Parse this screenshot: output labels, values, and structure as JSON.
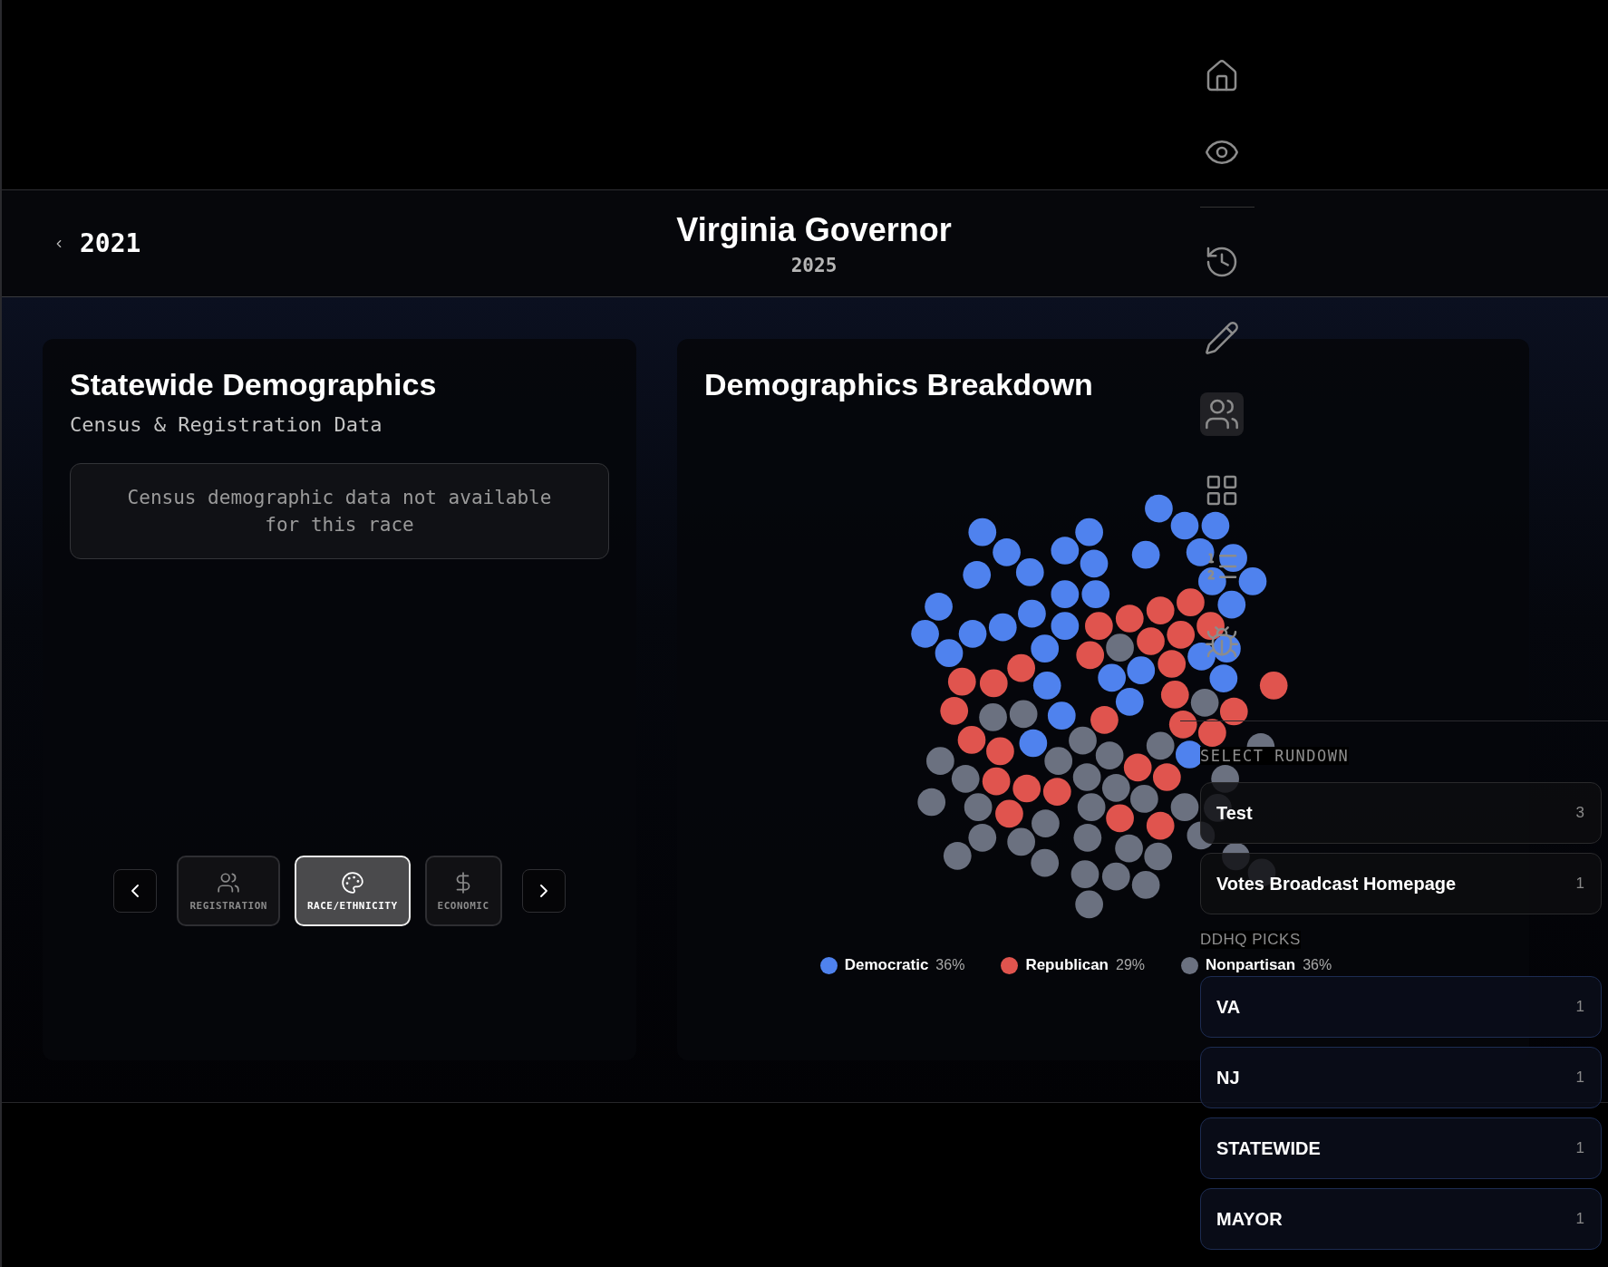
{
  "nav": [
    {
      "selected": false
    },
    {
      "selected": false
    },
    {
      "selected": false
    },
    {
      "selected": false
    },
    {
      "selected": true
    },
    {
      "selected": false
    },
    {
      "selected": false
    },
    {
      "selected": false
    }
  ],
  "header": {
    "previous_year": "2021",
    "title": "Virginia Governor",
    "year": "2025"
  },
  "demographics": {
    "title": "Statewide Demographics",
    "subtitle": "Census & Registration Data",
    "notice": "Census demographic data not available for this race",
    "categories": [
      {
        "label": "REGISTRATION",
        "selected": false
      },
      {
        "label": "RACE/ETHNICITY",
        "selected": true
      },
      {
        "label": "ECONOMIC",
        "selected": false
      }
    ]
  },
  "breakdown": {
    "title": "Demographics Breakdown",
    "legend": [
      {
        "name": "Democratic",
        "share": "36%",
        "color": "#4f82ee"
      },
      {
        "name": "Republican",
        "share": "29%",
        "color": "#e0544e"
      },
      {
        "name": "Nonpartisan",
        "share": "36%",
        "color": "#6b7180"
      }
    ]
  },
  "rundown": {
    "label": "SELECT RUNDOWN",
    "items": [
      {
        "name": "Test",
        "count": "3"
      },
      {
        "name": "Votes Broadcast Homepage",
        "count": "1"
      }
    ]
  },
  "picks": {
    "label": "DDHQ PICKS",
    "items": [
      {
        "name": "VA",
        "count": "1"
      },
      {
        "name": "NJ",
        "count": "1"
      },
      {
        "name": "STATEWIDE",
        "count": "1"
      },
      {
        "name": "MAYOR",
        "count": "1"
      }
    ]
  }
}
